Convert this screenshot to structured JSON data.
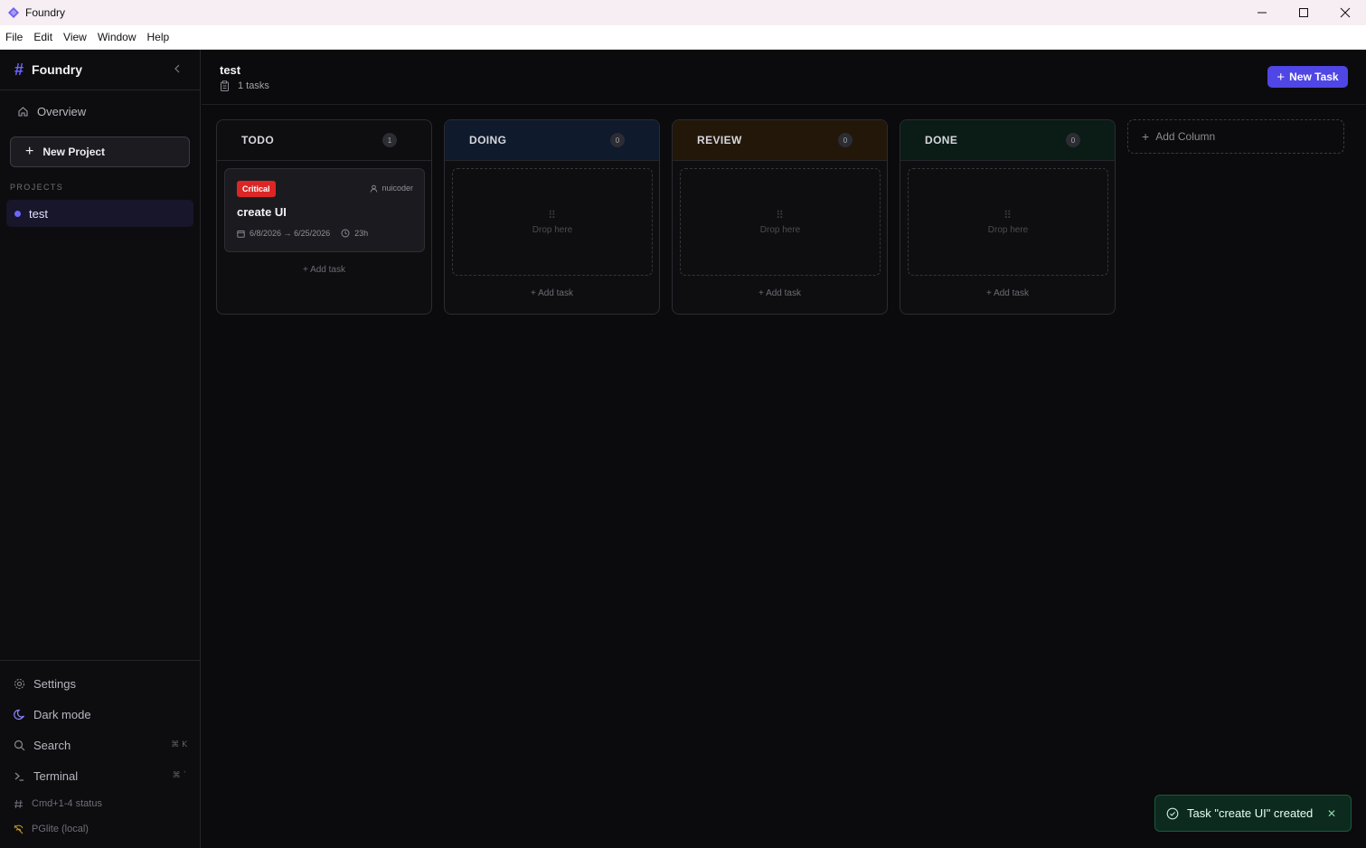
{
  "window": {
    "title": "Foundry",
    "menu": [
      "File",
      "Edit",
      "View",
      "Window",
      "Help"
    ],
    "controls": {
      "minimize": "—",
      "maximize": "☐",
      "close": "✕"
    }
  },
  "sidebar": {
    "brand": "Foundry",
    "overview": "Overview",
    "new_project": "New Project",
    "projects_heading": "PROJECTS",
    "projects": [
      {
        "name": "test",
        "color": "#6d67ff"
      }
    ],
    "bottom": {
      "settings": "Settings",
      "dark_mode": "Dark mode",
      "search": "Search",
      "search_kbd": "⌘ K",
      "terminal": "Terminal",
      "terminal_kbd": "⌘ `",
      "status_hint": "Cmd+1-4 status",
      "db": "PGlite (local)"
    }
  },
  "header": {
    "title": "test",
    "task_count": "1 tasks",
    "new_task": "New Task"
  },
  "board": {
    "columns": [
      {
        "title": "TODO",
        "count": "1",
        "color": "#0e0e11"
      },
      {
        "title": "DOING",
        "count": "0",
        "color": "#0f1a2c"
      },
      {
        "title": "REVIEW",
        "count": "0",
        "color": "#221709"
      },
      {
        "title": "DONE",
        "count": "0",
        "color": "#0a1c15"
      }
    ],
    "drop_here": "Drop here",
    "add_task": "Add task",
    "add_column": "Add Column",
    "card": {
      "priority": "Critical",
      "assignee": "nuicoder",
      "title": "create UI",
      "start": "6/8/2026",
      "end": "6/25/2026",
      "estimate": "23h"
    }
  },
  "toast": {
    "message": "Task \"create UI\" created",
    "close": "✕"
  },
  "colors": {
    "accent": "#4f46e5",
    "critical": "#dc2626",
    "toast_bg": "#0c2a1e"
  }
}
